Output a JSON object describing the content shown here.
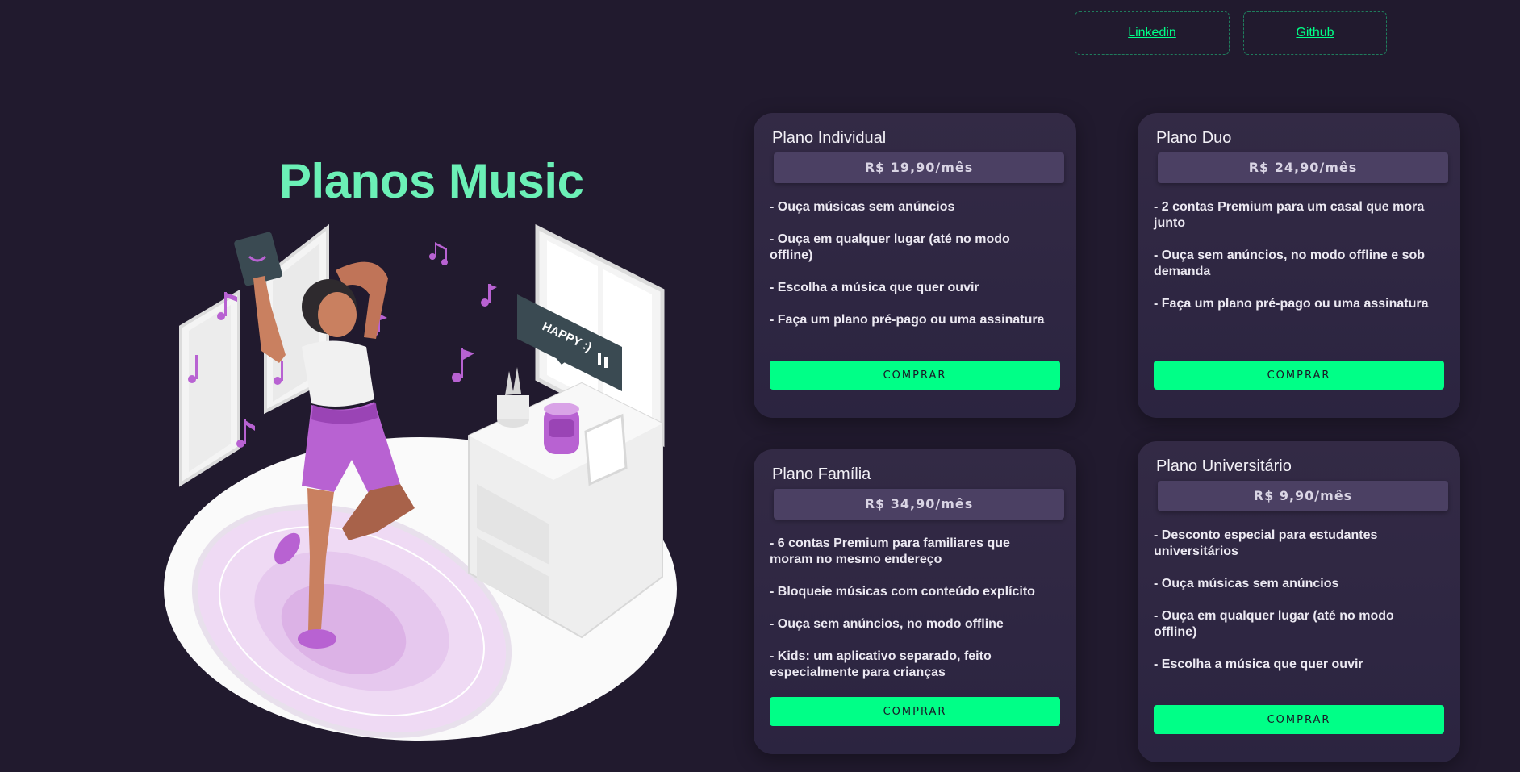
{
  "header": {
    "links": [
      {
        "label": "Linkedin"
      },
      {
        "label": "Github"
      }
    ]
  },
  "hero": {
    "title": "Planos Music",
    "illustration_text": "HAPPY :)"
  },
  "plans": [
    {
      "name": "Plano Individual",
      "price": "R$ 19,90/mês",
      "features": [
        "- Ouça músicas sem anúncios",
        "- Ouça em qualquer lugar (até no modo offline)",
        "- Escolha a música que quer ouvir",
        "- Faça um plano pré-pago ou uma assinatura"
      ],
      "button": "COMPRAR"
    },
    {
      "name": "Plano Duo",
      "price": "R$ 24,90/mês",
      "features": [
        "- 2 contas Premium para um casal que mora junto",
        "- Ouça sem anúncios, no modo offline e sob demanda",
        "- Faça um plano pré-pago ou uma assinatura"
      ],
      "button": "COMPRAR"
    },
    {
      "name": "Plano Família",
      "price": "R$ 34,90/mês",
      "features": [
        "- 6 contas Premium para familiares que moram no mesmo endereço",
        "- Bloqueie músicas com conteúdo explícito",
        "- Ouça sem anúncios, no modo offline",
        "- Kids: um aplicativo separado, feito especialmente para crianças"
      ],
      "button": "COMPRAR"
    },
    {
      "name": "Plano Universitário",
      "price": "R$ 9,90/mês",
      "features": [
        "- Desconto especial para estudantes universitários",
        "- Ouça músicas sem anúncios",
        "- Ouça em qualquer lugar (até no modo offline)",
        "- Escolha a música que quer ouvir"
      ],
      "button": "COMPRAR"
    }
  ],
  "colors": {
    "background": "#211a2e",
    "accent": "#00ff87",
    "title": "#6bf0b6",
    "card": "#2f2742",
    "price_bar": "#4b4063",
    "illustration_purple": "#b862d2"
  }
}
